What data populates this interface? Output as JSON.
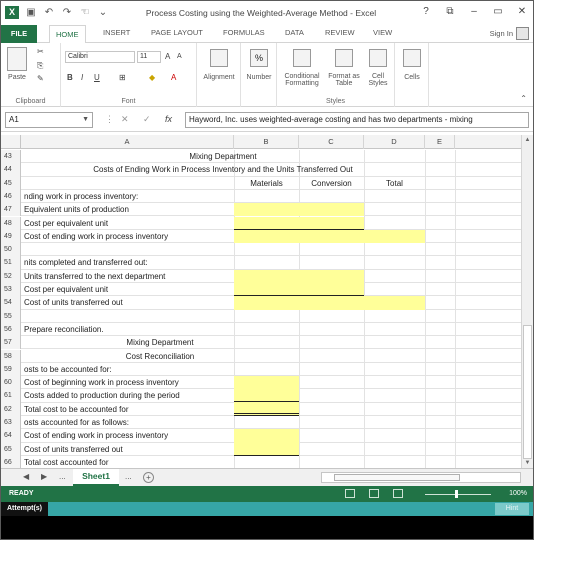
{
  "window": {
    "title": "Process Costing using the Weighted-Average Method - Excel",
    "controls": [
      "?",
      "⧉",
      "–",
      "▭",
      "✕"
    ]
  },
  "tabs": [
    "FILE",
    "HOME",
    "INSERT",
    "PAGE LAYOUT",
    "FORMULAS",
    "DATA",
    "REVIEW",
    "VIEW"
  ],
  "account": {
    "signin": "Sign In"
  },
  "ribbon": {
    "paste": "Paste",
    "clipboard": "Clipboard",
    "font_name": "Calibri",
    "font_size": "11",
    "bold": "B",
    "italic": "I",
    "underline": "U",
    "font_group": "Font",
    "alignment": "Alignment",
    "number": "Number",
    "cond_format": "Conditional Formatting",
    "format_table": "Format as Table",
    "cell_styles": "Cell Styles",
    "styles_group": "Styles",
    "cells": "Cells"
  },
  "formula_bar": {
    "name_box": "A1",
    "fx": "fx",
    "content": "Hayword, Inc. uses weighted-average costing and has two departments - mixing"
  },
  "columns": [
    "A",
    "B",
    "C",
    "D",
    "E"
  ],
  "rows": [
    {
      "n": "43",
      "a": "",
      "center": "Mixing Department",
      "b": "",
      "c": ""
    },
    {
      "n": "44",
      "a": "",
      "center": "Costs of Ending Work in Process Inventory and the Units Transferred Out",
      "b": "",
      "c": ""
    },
    {
      "n": "45",
      "a": "",
      "center": "",
      "b": "Materials",
      "c": "Conversion",
      "d": "Total"
    },
    {
      "n": "46",
      "a": "nding work in process inventory:"
    },
    {
      "n": "47",
      "a": "Equivalent units of production"
    },
    {
      "n": "48",
      "a": "Cost per equivalent unit"
    },
    {
      "n": "49",
      "a": "Cost of ending work in process inventory"
    },
    {
      "n": "50",
      "a": ""
    },
    {
      "n": "51",
      "a": "nits completed and transferred out:"
    },
    {
      "n": "52",
      "a": "Units transferred to the next department"
    },
    {
      "n": "53",
      "a": "Cost per equivalent unit"
    },
    {
      "n": "54",
      "a": "Cost of units transferred out"
    },
    {
      "n": "55",
      "a": ""
    },
    {
      "n": "56",
      "a": "  Prepare reconciliation."
    },
    {
      "n": "57",
      "a": "",
      "center2": "Mixing Department"
    },
    {
      "n": "58",
      "a": "",
      "center2": "Cost Reconciliation"
    },
    {
      "n": "59",
      "a": "osts to be accounted for:"
    },
    {
      "n": "60",
      "a": "Cost of beginning work in process inventory"
    },
    {
      "n": "61",
      "a": "Costs added to production during the period"
    },
    {
      "n": "62",
      "a": "Total cost to be accounted for"
    },
    {
      "n": "63",
      "a": "osts accounted for as follows:"
    },
    {
      "n": "64",
      "a": "Cost of ending work in process inventory"
    },
    {
      "n": "65",
      "a": "Cost of units transferred out"
    },
    {
      "n": "66",
      "a": "Total cost accounted for"
    }
  ],
  "sheet": {
    "name": "Sheet1",
    "ellipsis": "...",
    "add": "+"
  },
  "status": {
    "ready": "READY",
    "zoom": "100%"
  },
  "footer": {
    "attempt": "Attempt(s)",
    "hint": "Hint"
  },
  "colors": {
    "accent": "#217346",
    "highlight": "#ffff99",
    "teal": "#36a6a6"
  }
}
